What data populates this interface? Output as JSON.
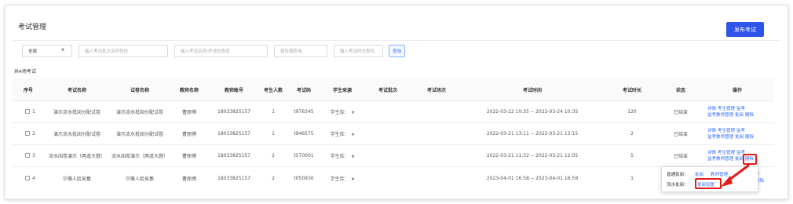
{
  "page": {
    "title": "考试管理",
    "publish_label": "发布考试"
  },
  "filters": {
    "scope_value": "全部",
    "batch_placeholder": "输入考试批次名称查找",
    "exam_placeholder": "输入考试名称/考试码查找",
    "date_placeholder": "按日期查询",
    "duration_placeholder": "输入考试时长查找",
    "query_label": "查询"
  },
  "summary": {
    "total_text": "共4场考试"
  },
  "table": {
    "headers": [
      "序号",
      "考试名称",
      "试卷名称",
      "教师名称",
      "教师账号",
      "考生人数",
      "考试码",
      "学生来源",
      "考试批次",
      "考试场次",
      "考试时间",
      "考试时长",
      "状态",
      "操作"
    ],
    "rows": [
      {
        "index": "1",
        "exam_name": "演示流水批阅分配试卷",
        "paper_name": "演示流水批阅分配试卷",
        "teacher": "曹丽博",
        "account": "18033825157",
        "count": "1",
        "code": "t976345",
        "source": "学生库：",
        "batch": "",
        "session": "",
        "time": "2022-03-22 10:35 -- 2022-03-24 10:35",
        "duration": "120",
        "status": "已结束"
      },
      {
        "index": "2",
        "exam_name": "演示流水批阅分配试卷",
        "paper_name": "演示流水批阅分配试卷",
        "teacher": "曹丽博",
        "account": "18033825157",
        "count": "1",
        "code": "t946575",
        "source": "学生库：",
        "batch": "",
        "session": "",
        "time": "2022-03-21 13:11 -- 2022-03-21 13:15",
        "duration": "2",
        "status": "已结束"
      },
      {
        "index": "3",
        "exam_name": "流水阅卷演示（两道大题）",
        "paper_name": "流水阅卷演示（两道大题）",
        "teacher": "曹丽博",
        "account": "18033825157",
        "count": "2",
        "code": "t570001",
        "source": "学生库：",
        "batch": "",
        "session": "",
        "time": "2022-03-21 11:52 -- 2022-03-21 12:05",
        "duration": "5",
        "status": "已结束"
      },
      {
        "index": "4",
        "exam_name": "尔雅人脸采集",
        "paper_name": "尔雅人脸采集",
        "teacher": "曹丽博",
        "account": "18033825157",
        "count": "2",
        "code": "t050930",
        "source": "学生库：",
        "batch": "",
        "session": "",
        "time": "2023-04-01 16:58 -- 2023-04-01 16:59",
        "duration": "1",
        "status": ""
      }
    ],
    "ops": {
      "details": "详情",
      "candidate_manage": "考生管理",
      "proctor": "监考",
      "proctor_teacher_manage": "监考教师管理",
      "grade": "批阅",
      "delete": "删除",
      "kao": "考"
    }
  },
  "popup": {
    "normal_label": "普通批阅：",
    "normal_grade": "批阅",
    "teacher_manage": "教师管理",
    "pipeline_label": "流水批阅：",
    "grade_settings": "批阅设置"
  }
}
